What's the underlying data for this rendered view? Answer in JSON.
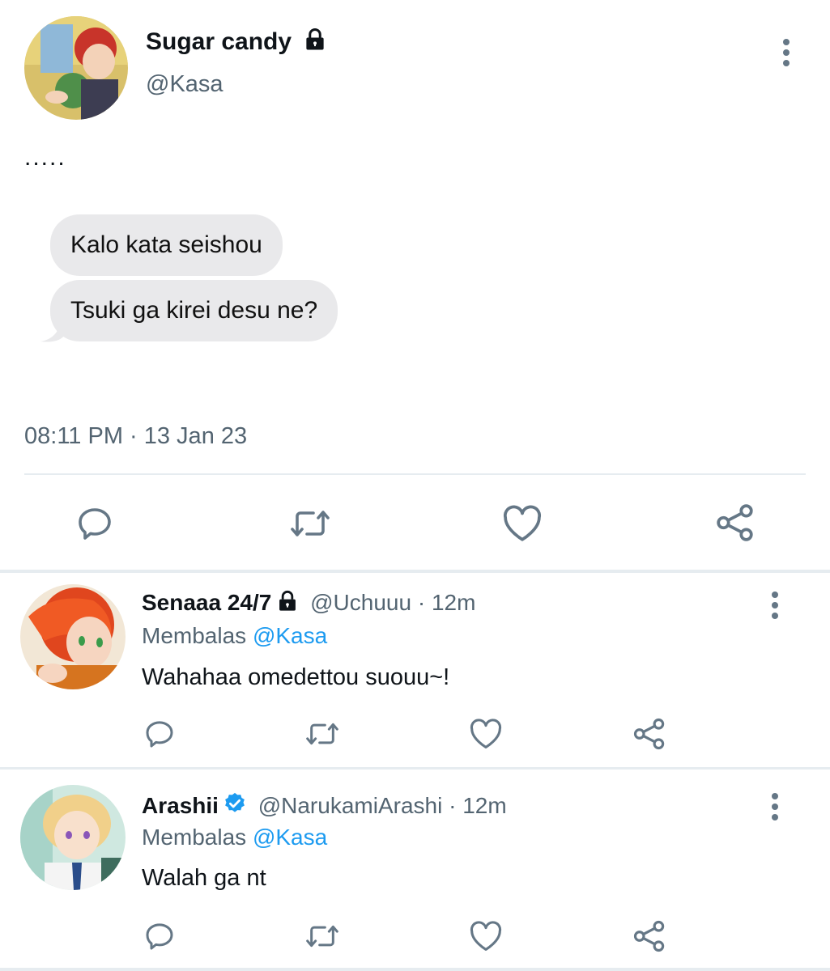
{
  "main_tweet": {
    "display_name": "Sugar candy",
    "handle": "@Kasa",
    "text": ".....",
    "bubbles": [
      "Kalo kata seishou",
      "Tsuki ga kirei desu ne?"
    ],
    "timestamp": "08:11 PM · 13 Jan 23",
    "actions": [
      "reply-icon",
      "retweet-icon",
      "like-icon",
      "share-icon"
    ]
  },
  "replies": [
    {
      "display_name": "Senaaa 24/7",
      "handle": "@Uchuuu",
      "time": "· 12m",
      "replying_prefix": "Membalas",
      "replying_to": "@Kasa",
      "text": "Wahahaa omedettou suouu~!"
    },
    {
      "display_name": "Arashii",
      "handle": "@NarukamiArashi",
      "time": "· 12m",
      "replying_prefix": "Membalas",
      "replying_to": "@Kasa",
      "text": "Walah ga nt"
    }
  ],
  "colors": {
    "link": "#1d9bf0",
    "muted": "#536471",
    "icon": "#657786",
    "bubble": "#e9e9eb",
    "verified": "#1d9bf0"
  }
}
